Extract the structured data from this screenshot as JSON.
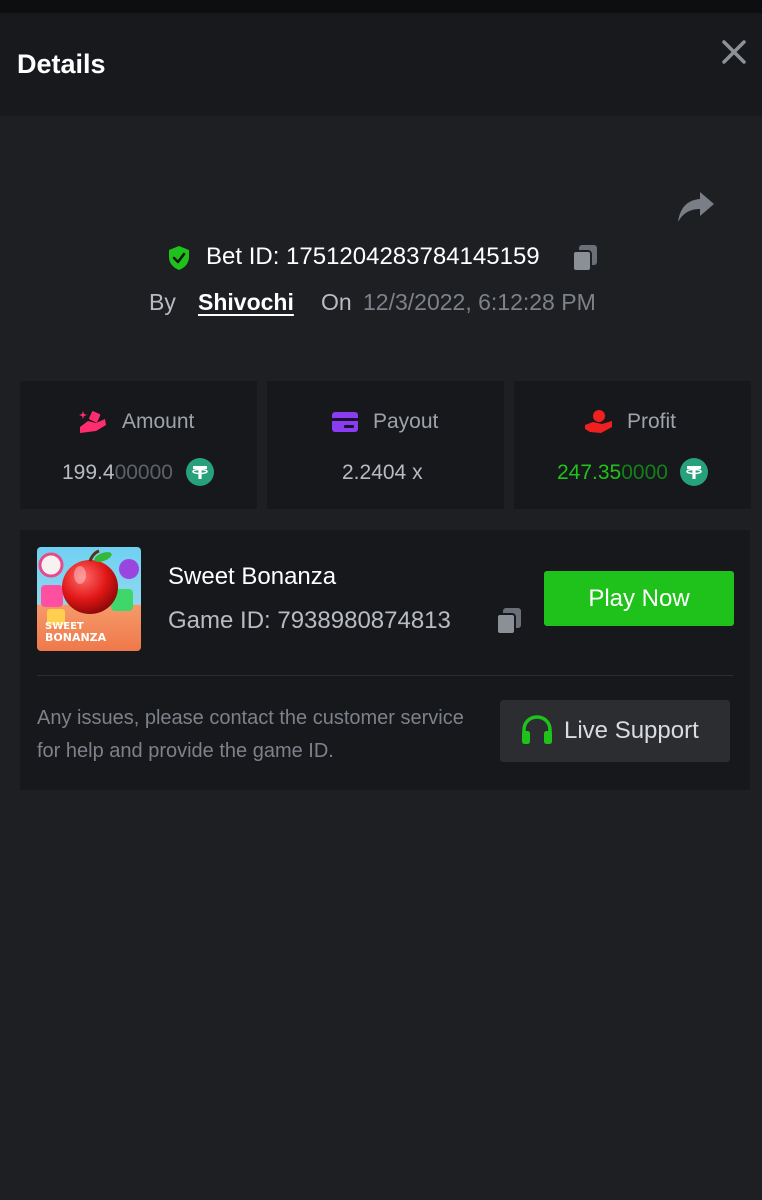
{
  "header": {
    "title": "Details"
  },
  "bet": {
    "id_label": "Bet ID: 1751204283784145159",
    "by_label": "By",
    "user": "Shivochi",
    "on_label": "On",
    "datetime": "12/3/2022, 6:12:28 PM"
  },
  "stats": {
    "amount": {
      "label": "Amount",
      "value_main": "199.4",
      "value_dim": "00000",
      "icon": "money-hand-icon",
      "icon_color": "#ff2d6f"
    },
    "payout": {
      "label": "Payout",
      "value": "2.2404 x",
      "icon": "card-icon",
      "icon_color": "#8a3cf0"
    },
    "profit": {
      "label": "Profit",
      "value_main": "247.35",
      "value_dim": "0000",
      "icon": "coin-hand-icon",
      "icon_color": "#f02020"
    }
  },
  "game": {
    "name": "Sweet Bonanza",
    "id_label": "Game ID: 7938980874813",
    "thumb_text_1": "SWEET",
    "thumb_text_2": "BONANZA",
    "play_label": "Play Now",
    "help_text": "Any issues, please contact the customer service for help and provide the game ID.",
    "support_label": "Live Support"
  },
  "colors": {
    "background": "#1e1f22",
    "card": "#17181b",
    "accent_green": "#1fc21b",
    "tether": "#26a17b",
    "profit_green": "#1fc21b"
  }
}
